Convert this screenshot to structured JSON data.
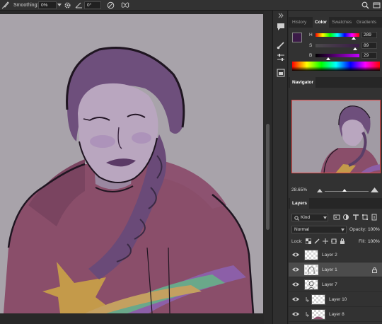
{
  "options_bar": {
    "smoothing_label": "Smoothing:",
    "smoothing_value": "0%",
    "angle_value": "0°"
  },
  "panels": {
    "color_group": {
      "tabs": [
        {
          "label": "History",
          "active": false
        },
        {
          "label": "Color",
          "active": true
        },
        {
          "label": "Swatches",
          "active": false
        },
        {
          "label": "Gradients",
          "active": false
        }
      ],
      "foreground_color": "#3b1a47",
      "sliders": [
        {
          "label": "H",
          "value": "289"
        },
        {
          "label": "S",
          "value": "89"
        },
        {
          "label": "B",
          "value": "29"
        }
      ]
    },
    "navigator": {
      "tab_label": "Navigator",
      "zoom_value": "28.65%"
    },
    "layers": {
      "tab_label": "Layers",
      "kind_filter": "Kind",
      "blend_mode": "Normal",
      "opacity_label": "Opacity:",
      "opacity_value": "100%",
      "lock_label": "Lock:",
      "fill_label": "Fill:",
      "fill_value": "100%",
      "items": [
        {
          "name": "Layer 2",
          "visible": true,
          "selected": false,
          "clipped": false
        },
        {
          "name": "Layer 1",
          "visible": true,
          "selected": true,
          "clipped": false,
          "locked": true
        },
        {
          "name": "Layer 7",
          "visible": true,
          "selected": false,
          "clipped": false
        },
        {
          "name": "Layer 10",
          "visible": true,
          "selected": false,
          "clipped": true
        },
        {
          "name": "Layer 8",
          "visible": true,
          "selected": false,
          "clipped": true
        }
      ]
    }
  }
}
